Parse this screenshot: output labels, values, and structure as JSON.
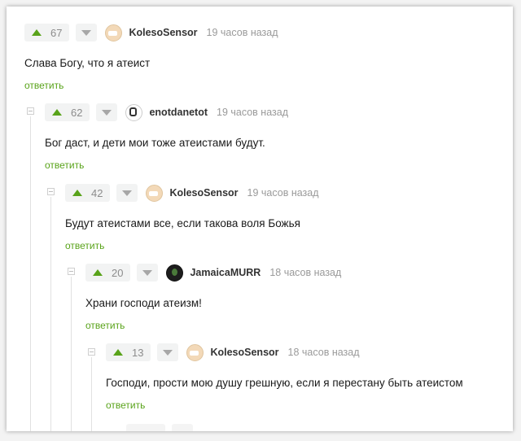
{
  "comments": [
    {
      "votes": "67",
      "user": "KolesoSensor",
      "time": "19 часов назад",
      "text": "Слава Богу, что я атеист",
      "reply": "ответить",
      "avatar": "sensor-face-avatar"
    },
    {
      "votes": "62",
      "user": "enotdanetot",
      "time": "19 часов назад",
      "text": "Бог даст, и дети мои тоже атеистами будут.",
      "reply": "ответить",
      "avatar": "raccoon-sketch-avatar"
    },
    {
      "votes": "42",
      "user": "KolesoSensor",
      "time": "19 часов назад",
      "text": "Будут атеистами все, если такова воля Божья",
      "reply": "ответить",
      "avatar": "sensor-face-avatar"
    },
    {
      "votes": "20",
      "user": "JamaicaMURR",
      "time": "18 часов назад",
      "text": "Храни господи атеизм!",
      "reply": "ответить",
      "avatar": "dark-figure-avatar"
    },
    {
      "votes": "13",
      "user": "KolesoSensor",
      "time": "18 часов назад",
      "text": "Господи, прости мою душу грешную, если я перестану быть атеистом",
      "reply": "ответить",
      "avatar": "sensor-face-avatar"
    }
  ],
  "colors": {
    "accent": "#59a31a",
    "downvote": "#a7a7a7",
    "username": "#333333",
    "time": "#9a9a9a"
  }
}
